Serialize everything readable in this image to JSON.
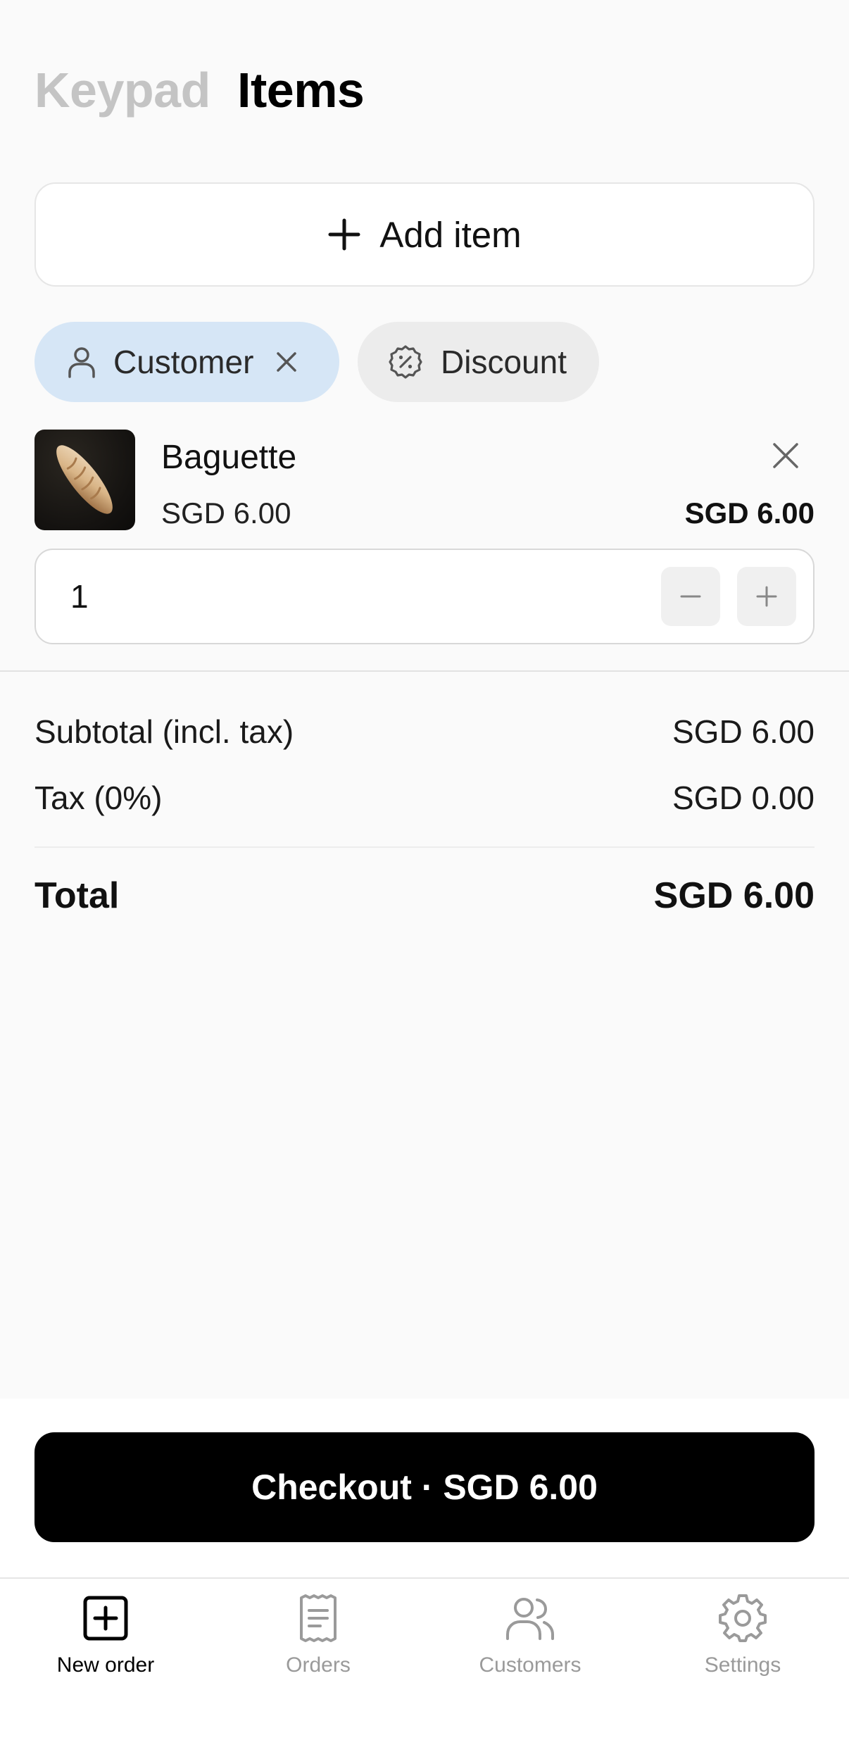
{
  "header": {
    "tabs": [
      {
        "label": "Keypad",
        "active": false
      },
      {
        "label": "Items",
        "active": true
      }
    ]
  },
  "add_item": {
    "label": "Add item",
    "icon": "plus-icon"
  },
  "chips": {
    "customer": {
      "label": "Customer",
      "icon": "user-icon",
      "selected": true
    },
    "discount": {
      "label": "Discount",
      "icon": "discount-badge-icon"
    }
  },
  "cart": {
    "items": [
      {
        "name": "Baguette",
        "unit_price": "SGD 6.00",
        "line_total": "SGD 6.00",
        "quantity": "1",
        "image": "baguette-photo"
      }
    ]
  },
  "summary": {
    "subtotal_label": "Subtotal (incl. tax)",
    "subtotal_value": "SGD 6.00",
    "tax_label": "Tax (0%)",
    "tax_value": "SGD 0.00",
    "total_label": "Total",
    "total_value": "SGD 6.00"
  },
  "checkout": {
    "label": "Checkout · SGD 6.00"
  },
  "bottom_nav": {
    "items": [
      {
        "label": "New order",
        "icon": "plus-square-icon",
        "active": true
      },
      {
        "label": "Orders",
        "icon": "receipt-icon",
        "active": false
      },
      {
        "label": "Customers",
        "icon": "users-icon",
        "active": false
      },
      {
        "label": "Settings",
        "icon": "gear-icon",
        "active": false
      }
    ]
  },
  "colors": {
    "background": "#fafafa",
    "customer_chip": "#d6e6f6",
    "discount_chip": "#ececec",
    "checkout_button": "#000000",
    "inactive_tab": "#c4c4c4",
    "inactive_nav": "#9a9a9a"
  }
}
